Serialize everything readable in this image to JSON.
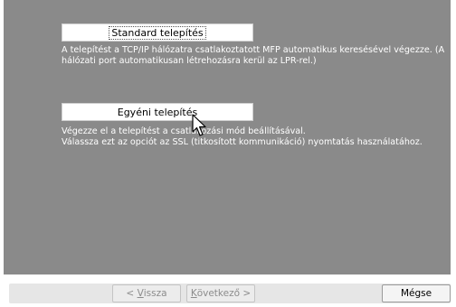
{
  "options": [
    {
      "button_label": "Standard telepítés",
      "description_lines": [
        "A telepítést a TCP/IP hálózatra csatlakoztatott MFP automatikus keresésével végezze. (A",
        "hálózati port automatikusan létrehozásra kerül az LPR-rel.)"
      ]
    },
    {
      "button_label": "Egyéni telepítés",
      "description_lines": [
        "Végezze el a telepítést a csatlakozási mód beállításával.",
        "Válassza ezt az opciót az SSL (titkosított kommunikáció) nyomtatás használatához."
      ]
    }
  ],
  "footer": {
    "back": {
      "prefix": "< ",
      "hotkey": "V",
      "rest": "issza"
    },
    "next": {
      "hotkey": "K",
      "rest": "övetkező",
      "suffix": " >"
    },
    "cancel": "Mégse"
  },
  "icons": {
    "cursor": "arrow-pointer-icon"
  },
  "colors": {
    "panel_bg": "#8a8a8a",
    "text_on_panel": "#ffffff",
    "disabled_text": "#8c8c8c"
  }
}
